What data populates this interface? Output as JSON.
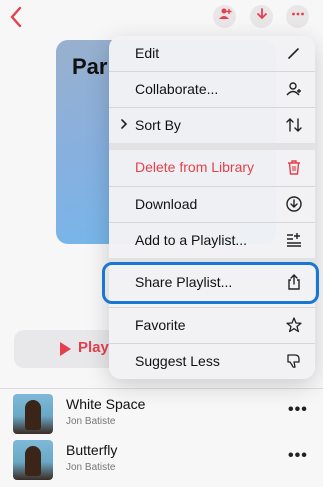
{
  "cover": {
    "title_partial": "Par"
  },
  "play": {
    "label": "Play"
  },
  "menu": {
    "items": [
      {
        "label": "Edit",
        "icon": "pencil-icon"
      },
      {
        "label": "Collaborate...",
        "icon": "person-add-icon"
      },
      {
        "label": "Sort By",
        "icon": "sort-arrows-icon"
      },
      {
        "label": "Delete from Library",
        "icon": "trash-icon",
        "color": "#e5404d"
      },
      {
        "label": "Download",
        "icon": "download-circle-icon"
      },
      {
        "label": "Add to a Playlist...",
        "icon": "add-to-playlist-icon"
      },
      {
        "label": "Share Playlist...",
        "icon": "share-icon"
      },
      {
        "label": "Favorite",
        "icon": "star-icon"
      },
      {
        "label": "Suggest Less",
        "icon": "thumbs-down-icon"
      }
    ]
  },
  "songs": [
    {
      "title": "White Space",
      "artist": "Jon Batiste"
    },
    {
      "title": "Butterfly",
      "artist": "Jon Batiste"
    }
  ],
  "colors": {
    "accent": "#e5404d",
    "highlight": "#1976d2"
  }
}
